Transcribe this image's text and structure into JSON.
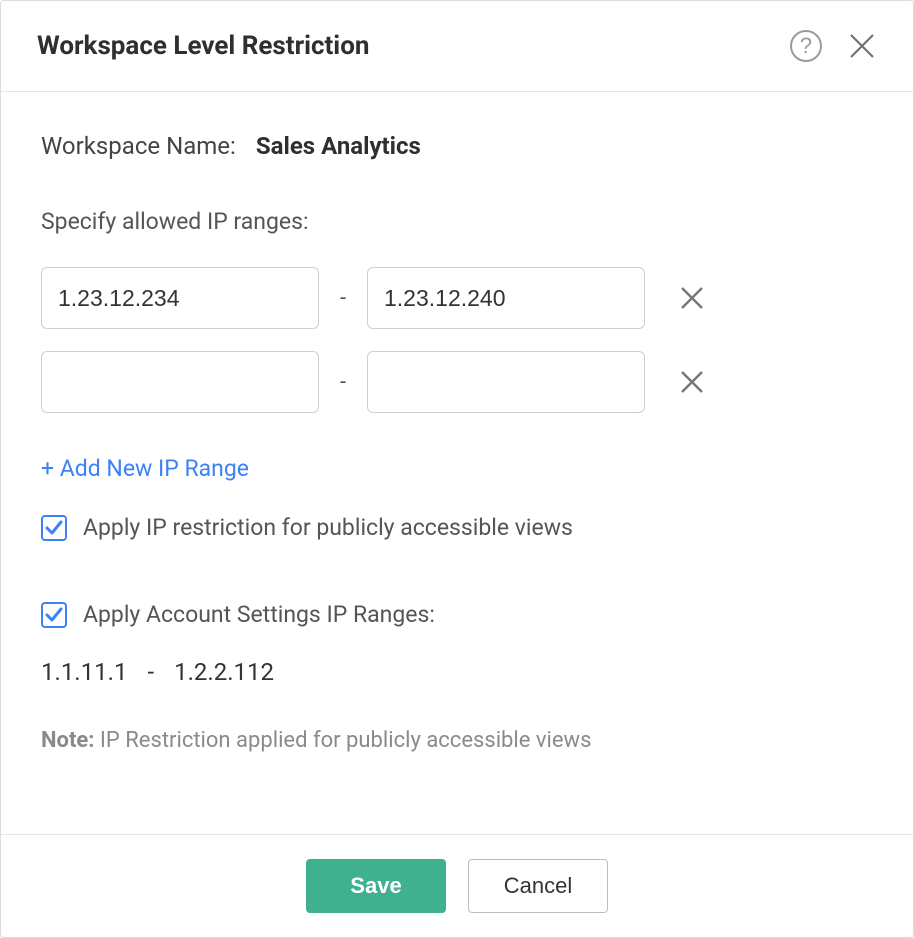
{
  "dialog": {
    "title": "Workspace Level Restriction"
  },
  "workspace": {
    "name_label": "Workspace Name:",
    "name_value": "Sales Analytics"
  },
  "ip_section": {
    "label": "Specify allowed IP ranges:",
    "rows": [
      {
        "from": "1.23.12.234",
        "to": "1.23.12.240"
      },
      {
        "from": "",
        "to": ""
      }
    ],
    "add_link": "+ Add New IP Range"
  },
  "options": {
    "apply_public_views": {
      "checked": true,
      "label": "Apply IP restriction for publicly accessible views"
    },
    "apply_account_ranges": {
      "checked": true,
      "label": "Apply Account Settings IP Ranges:"
    }
  },
  "account_range": {
    "from": "1.1.11.1",
    "dash": "-",
    "to": "1.2.2.112"
  },
  "note": {
    "prefix": "Note:",
    "text": " IP Restriction applied for publicly accessible views"
  },
  "footer": {
    "save": "Save",
    "cancel": "Cancel"
  },
  "glyphs": {
    "dash": "-"
  }
}
